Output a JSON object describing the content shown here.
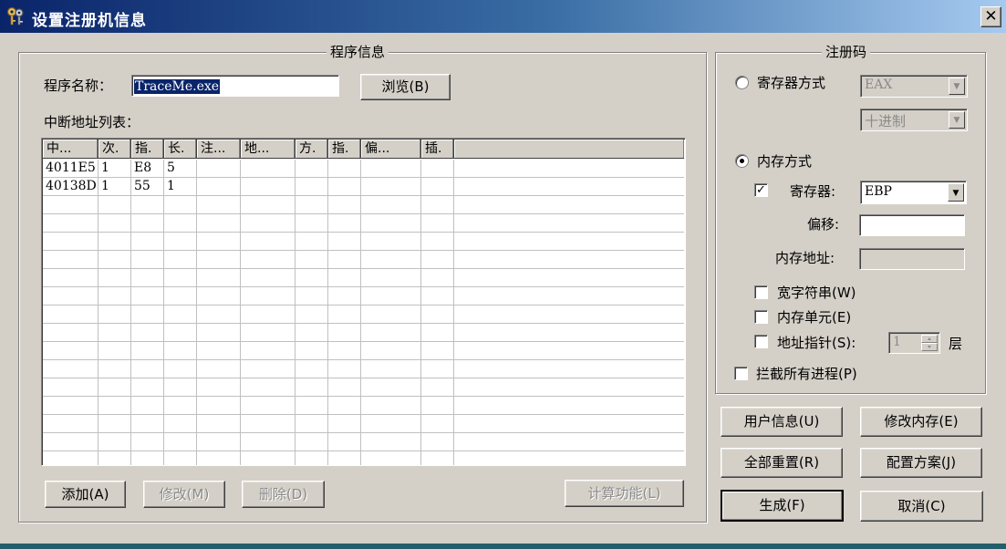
{
  "window": {
    "title": "设置注册机信息",
    "close_label": "✕"
  },
  "program_group": {
    "legend": "程序信息",
    "name_label": "程序名称：",
    "name_value": "TraceMe.exe",
    "browse_button": "浏览(B)",
    "bp_list_label": "中断地址列表：",
    "columns": [
      "中...",
      "次.",
      "指.",
      "长.",
      "注...",
      "地...",
      "方.",
      "指.",
      "偏...",
      "插.",
      ""
    ],
    "rows": [
      [
        "4011E5",
        "1",
        "E8",
        "5",
        "",
        "",
        "",
        "",
        "",
        "",
        ""
      ],
      [
        "40138D",
        "1",
        "55",
        "1",
        "",
        "",
        "",
        "",
        "",
        "",
        ""
      ]
    ],
    "buttons": {
      "add": "添加(A)",
      "modify": "修改(M)",
      "delete": "删除(D)",
      "calc": "计算功能(L)"
    }
  },
  "regcode_group": {
    "legend": "注册码",
    "register_mode_label": "寄存器方式",
    "register_mode_selected": false,
    "register_select": "EAX",
    "radix_select": "十进制",
    "memory_mode_label": "内存方式",
    "memory_mode_selected": true,
    "mem_register_checked": true,
    "mem_register_label": "寄存器:",
    "mem_register_select": "EBP",
    "offset_label": "偏移:",
    "offset_value": "",
    "mem_addr_label": "内存地址:",
    "mem_addr_value": "",
    "wide_string_label": "宽字符串(W)",
    "mem_unit_label": "内存单元(E)",
    "addr_pointer_label": "地址指针(S):",
    "pointer_level_value": "1",
    "level_unit": "层",
    "intercept_all_label": "拦截所有进程(P)"
  },
  "actions": {
    "user_info": "用户信息(U)",
    "modify_mem": "修改内存(E)",
    "reset_all": "全部重置(R)",
    "config_scheme": "配置方案(J)",
    "generate": "生成(F)",
    "cancel": "取消(C)"
  }
}
